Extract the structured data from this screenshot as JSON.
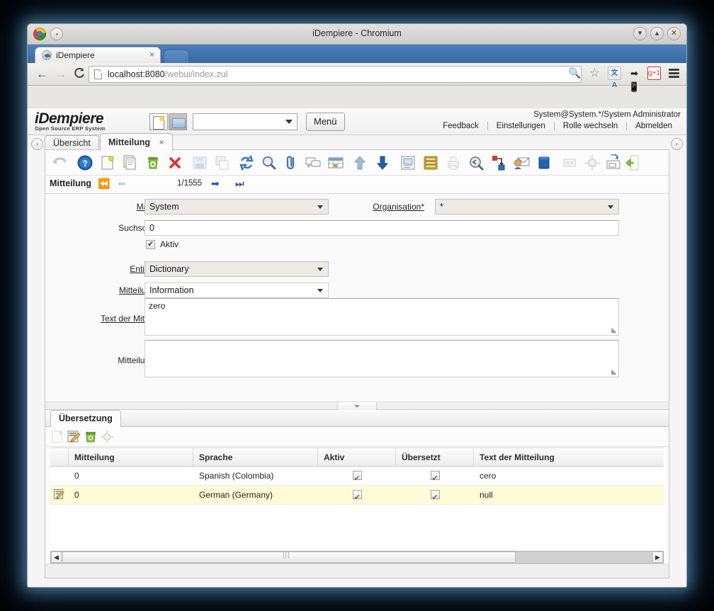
{
  "window": {
    "title": "iDempiere - Chromium",
    "buttons": [
      "minimize",
      "maximize",
      "close"
    ]
  },
  "browser": {
    "tab": {
      "label": "iDempiere",
      "close": "×"
    },
    "nav": {
      "back": "←",
      "forward": "→",
      "reload": "⟳"
    },
    "url": {
      "host": "localhost:8080",
      "path": "/webui/index.zul"
    },
    "omnibox_icons": [
      "zoom-icon",
      "bookmark-star-icon",
      "translate-icon",
      "mobile-icon",
      "google-plus-icon",
      "chrome-menu-icon"
    ],
    "gplus_label": "g+1"
  },
  "app": {
    "logo": {
      "line1": "iDempiere",
      "line2": "Open Source  ERP System"
    },
    "menu_button": "Menü",
    "header_combo_value": "",
    "user_line": "System@System.*/System Administrator",
    "user_links": [
      "Feedback",
      "Einstellungen",
      "Rolle wechseln",
      "Abmelden"
    ],
    "left_collapse": "›",
    "right_collapse": "‹"
  },
  "window_tabs": [
    {
      "label": "Übersicht",
      "active": false,
      "closable": false
    },
    {
      "label": "Mitteilung",
      "active": true,
      "closable": true,
      "close": "×"
    }
  ],
  "toolbar": {
    "icons": [
      "undo-icon",
      "help-icon",
      "new-record-icon",
      "copy-record-icon",
      "delete-record-icon",
      "delete-selection-icon",
      "save-icon",
      "save-create-icon",
      "refresh-icon",
      "find-icon",
      "attachment-icon",
      "chat-icon",
      "grid-toggle-icon",
      "parent-record-icon",
      "detail-record-icon",
      "report-icon",
      "archive-icon",
      "print-icon",
      "zoom-across-icon",
      "export-icon",
      "request-icon",
      "product-info-icon",
      "csv-import-icon",
      "preference-icon",
      "archive-document-icon",
      "exit-icon"
    ]
  },
  "record_nav": {
    "label": "Mitteilung",
    "first": "first-record",
    "prev": "previous-record",
    "counter": "1/1555",
    "next": "next-record",
    "last": "last-record"
  },
  "form": {
    "fields": [
      {
        "name": "mandant",
        "label": "Mandant",
        "required": true,
        "type": "select",
        "value": "System",
        "readonly": true
      },
      {
        "name": "organisation",
        "label": "Organisation",
        "required": true,
        "type": "select",
        "value": "*",
        "readonly": true
      },
      {
        "name": "suchschluessel",
        "label": "Suchschlüssel",
        "required": false,
        "type": "text",
        "value": "0"
      },
      {
        "name": "aktiv",
        "label": "Aktiv",
        "required": false,
        "type": "checkbox",
        "checked": true
      },
      {
        "name": "entitaetstyp",
        "label": "Entitätstyp",
        "required": true,
        "type": "select",
        "value": "Dictionary",
        "readonly": true
      },
      {
        "name": "mitteilungsart",
        "label": "Mitteilungsart",
        "required": true,
        "type": "select",
        "value": "Information",
        "readonly": false
      },
      {
        "name": "text_der_mitteilung",
        "label": "Text der Mitteilung",
        "required": true,
        "type": "textarea",
        "value": "zero"
      },
      {
        "name": "mitteilungs_tip",
        "label": "Mitteilungs-Tip",
        "required": false,
        "type": "textarea",
        "value": ""
      }
    ],
    "required_marker": "*"
  },
  "bottom_panel": {
    "tab": "Übersetzung",
    "toolbar_icons": [
      "new-record-icon",
      "edit-record-icon",
      "delete-record-icon",
      "process-icon"
    ],
    "grid": {
      "columns": [
        "",
        "Mitteilung",
        "Sprache",
        "Aktiv",
        "Übersetzt",
        "Text der Mitteilung"
      ],
      "rows": [
        {
          "selected": false,
          "marker": "",
          "mitteilung": "0",
          "sprache": "Spanish (Colombia)",
          "aktiv": true,
          "uebersetzt": true,
          "text": "cero"
        },
        {
          "selected": true,
          "marker": "edit-row-icon",
          "mitteilung": "0",
          "sprache": "German (Germany)",
          "aktiv": true,
          "uebersetzt": true,
          "text": "null"
        }
      ]
    },
    "hscroll": {
      "left_arrow": "◀",
      "right_arrow": "▶",
      "grip": "|||"
    }
  },
  "colors": {
    "accent_blue": "#4a7ebb",
    "selected_row": "#fdfcd6",
    "panel_bg": "#fafafa"
  }
}
